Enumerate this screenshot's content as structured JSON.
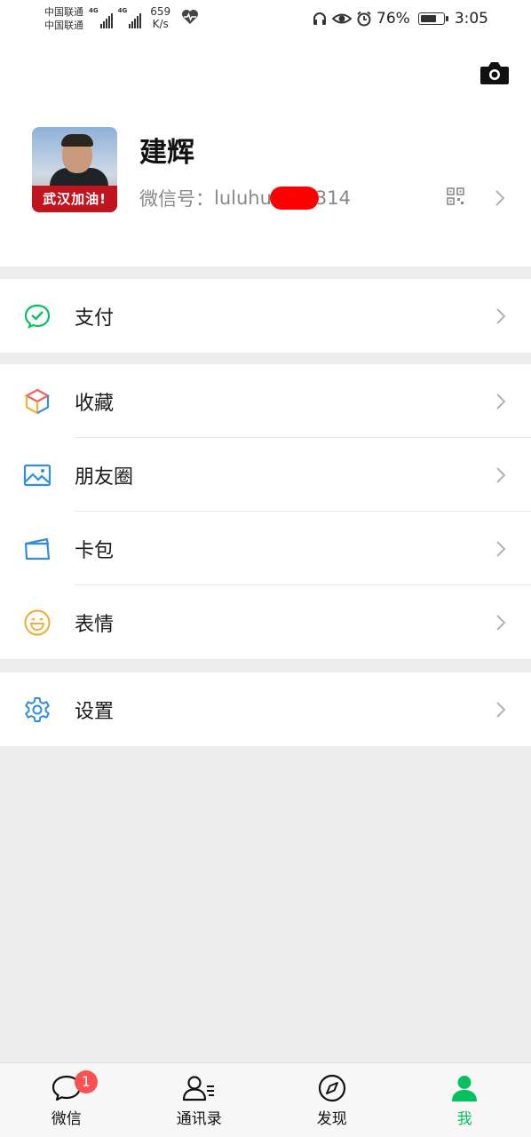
{
  "status_bar": {
    "carrier_1": "中国联通",
    "carrier_2": "中国联通",
    "net_1": "4G",
    "net_2": "4G",
    "speed_value": "659",
    "speed_unit": "K/s",
    "battery": "76%",
    "battery_level": 0.76,
    "time": "3:05"
  },
  "profile": {
    "name": "建辉",
    "wechat_id_label": "微信号：",
    "wechat_id_prefix": "luluhu",
    "wechat_id_suffix": "314",
    "avatar_banner": "武汉加油!"
  },
  "menu": {
    "pay": {
      "label": "支付",
      "icon": "wechat-pay-icon",
      "color": "#07c160"
    },
    "favorites": {
      "label": "收藏",
      "icon": "favorites-cube-icon"
    },
    "moments": {
      "label": "朋友圈",
      "icon": "moments-picture-icon",
      "color": "#2f8ee0"
    },
    "cards": {
      "label": "卡包",
      "icon": "card-wallet-icon",
      "color": "#2f8ee0"
    },
    "stickers": {
      "label": "表情",
      "icon": "smiley-icon",
      "color": "#f0b040"
    },
    "settings": {
      "label": "设置",
      "icon": "gear-icon",
      "color": "#2f8ee0"
    }
  },
  "tabbar": {
    "chats": {
      "label": "微信",
      "badge": "1"
    },
    "contacts": {
      "label": "通讯录"
    },
    "discover": {
      "label": "发现"
    },
    "me": {
      "label": "我",
      "active_color": "#07c160"
    }
  }
}
